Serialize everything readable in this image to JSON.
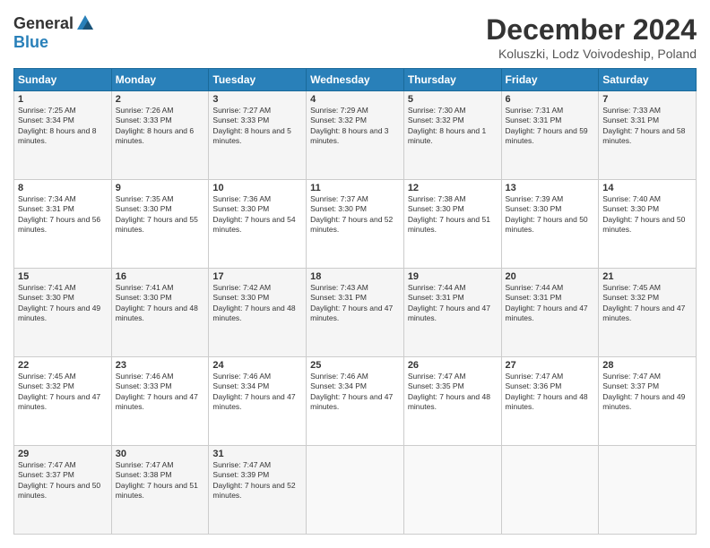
{
  "logo": {
    "general": "General",
    "blue": "Blue"
  },
  "title": "December 2024",
  "subtitle": "Koluszki, Lodz Voivodeship, Poland",
  "days_of_week": [
    "Sunday",
    "Monday",
    "Tuesday",
    "Wednesday",
    "Thursday",
    "Friday",
    "Saturday"
  ],
  "weeks": [
    [
      {
        "day": "1",
        "sunrise": "7:25 AM",
        "sunset": "3:34 PM",
        "daylight": "8 hours and 8 minutes."
      },
      {
        "day": "2",
        "sunrise": "7:26 AM",
        "sunset": "3:33 PM",
        "daylight": "8 hours and 6 minutes."
      },
      {
        "day": "3",
        "sunrise": "7:27 AM",
        "sunset": "3:33 PM",
        "daylight": "8 hours and 5 minutes."
      },
      {
        "day": "4",
        "sunrise": "7:29 AM",
        "sunset": "3:32 PM",
        "daylight": "8 hours and 3 minutes."
      },
      {
        "day": "5",
        "sunrise": "7:30 AM",
        "sunset": "3:32 PM",
        "daylight": "8 hours and 1 minute."
      },
      {
        "day": "6",
        "sunrise": "7:31 AM",
        "sunset": "3:31 PM",
        "daylight": "7 hours and 59 minutes."
      },
      {
        "day": "7",
        "sunrise": "7:33 AM",
        "sunset": "3:31 PM",
        "daylight": "7 hours and 58 minutes."
      }
    ],
    [
      {
        "day": "8",
        "sunrise": "7:34 AM",
        "sunset": "3:31 PM",
        "daylight": "7 hours and 56 minutes."
      },
      {
        "day": "9",
        "sunrise": "7:35 AM",
        "sunset": "3:30 PM",
        "daylight": "7 hours and 55 minutes."
      },
      {
        "day": "10",
        "sunrise": "7:36 AM",
        "sunset": "3:30 PM",
        "daylight": "7 hours and 54 minutes."
      },
      {
        "day": "11",
        "sunrise": "7:37 AM",
        "sunset": "3:30 PM",
        "daylight": "7 hours and 52 minutes."
      },
      {
        "day": "12",
        "sunrise": "7:38 AM",
        "sunset": "3:30 PM",
        "daylight": "7 hours and 51 minutes."
      },
      {
        "day": "13",
        "sunrise": "7:39 AM",
        "sunset": "3:30 PM",
        "daylight": "7 hours and 50 minutes."
      },
      {
        "day": "14",
        "sunrise": "7:40 AM",
        "sunset": "3:30 PM",
        "daylight": "7 hours and 50 minutes."
      }
    ],
    [
      {
        "day": "15",
        "sunrise": "7:41 AM",
        "sunset": "3:30 PM",
        "daylight": "7 hours and 49 minutes."
      },
      {
        "day": "16",
        "sunrise": "7:41 AM",
        "sunset": "3:30 PM",
        "daylight": "7 hours and 48 minutes."
      },
      {
        "day": "17",
        "sunrise": "7:42 AM",
        "sunset": "3:30 PM",
        "daylight": "7 hours and 48 minutes."
      },
      {
        "day": "18",
        "sunrise": "7:43 AM",
        "sunset": "3:31 PM",
        "daylight": "7 hours and 47 minutes."
      },
      {
        "day": "19",
        "sunrise": "7:44 AM",
        "sunset": "3:31 PM",
        "daylight": "7 hours and 47 minutes."
      },
      {
        "day": "20",
        "sunrise": "7:44 AM",
        "sunset": "3:31 PM",
        "daylight": "7 hours and 47 minutes."
      },
      {
        "day": "21",
        "sunrise": "7:45 AM",
        "sunset": "3:32 PM",
        "daylight": "7 hours and 47 minutes."
      }
    ],
    [
      {
        "day": "22",
        "sunrise": "7:45 AM",
        "sunset": "3:32 PM",
        "daylight": "7 hours and 47 minutes."
      },
      {
        "day": "23",
        "sunrise": "7:46 AM",
        "sunset": "3:33 PM",
        "daylight": "7 hours and 47 minutes."
      },
      {
        "day": "24",
        "sunrise": "7:46 AM",
        "sunset": "3:34 PM",
        "daylight": "7 hours and 47 minutes."
      },
      {
        "day": "25",
        "sunrise": "7:46 AM",
        "sunset": "3:34 PM",
        "daylight": "7 hours and 47 minutes."
      },
      {
        "day": "26",
        "sunrise": "7:47 AM",
        "sunset": "3:35 PM",
        "daylight": "7 hours and 48 minutes."
      },
      {
        "day": "27",
        "sunrise": "7:47 AM",
        "sunset": "3:36 PM",
        "daylight": "7 hours and 48 minutes."
      },
      {
        "day": "28",
        "sunrise": "7:47 AM",
        "sunset": "3:37 PM",
        "daylight": "7 hours and 49 minutes."
      }
    ],
    [
      {
        "day": "29",
        "sunrise": "7:47 AM",
        "sunset": "3:37 PM",
        "daylight": "7 hours and 50 minutes."
      },
      {
        "day": "30",
        "sunrise": "7:47 AM",
        "sunset": "3:38 PM",
        "daylight": "7 hours and 51 minutes."
      },
      {
        "day": "31",
        "sunrise": "7:47 AM",
        "sunset": "3:39 PM",
        "daylight": "7 hours and 52 minutes."
      },
      null,
      null,
      null,
      null
    ]
  ]
}
